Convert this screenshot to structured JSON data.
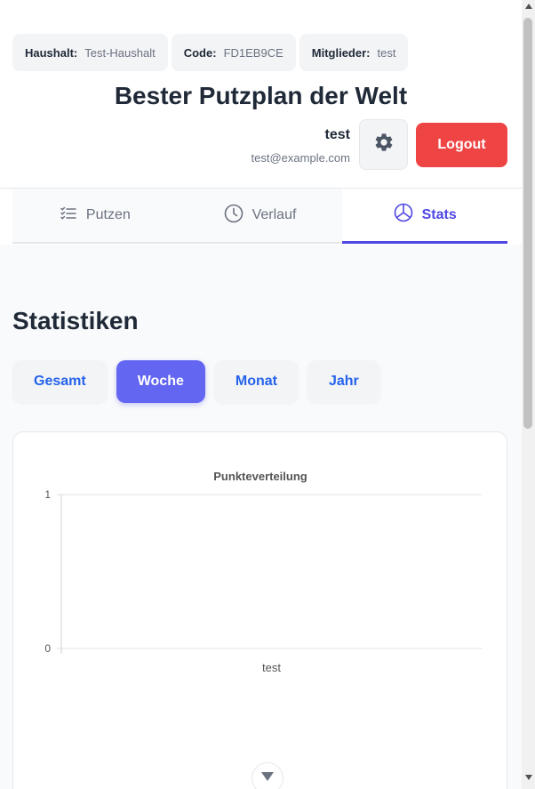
{
  "household": {
    "household_label": "Haushalt:",
    "household_value": "Test-Haushalt",
    "code_label": "Code:",
    "code_value": "FD1EB9CE",
    "members_label": "Mitglieder:",
    "members_value": "test"
  },
  "app": {
    "title": "Bester Putzplan der Welt"
  },
  "user": {
    "name": "test",
    "email": "test@example.com"
  },
  "header": {
    "settings_icon": "gear-icon",
    "logout_label": "Logout"
  },
  "tabs": [
    {
      "label": "Putzen",
      "icon": "list-check-icon",
      "active": false
    },
    {
      "label": "Verlauf",
      "icon": "clock-icon",
      "active": false
    },
    {
      "label": "Stats",
      "icon": "pie-chart-icon",
      "active": true
    }
  ],
  "stats": {
    "title": "Statistiken",
    "filters": [
      {
        "label": "Gesamt",
        "active": false
      },
      {
        "label": "Woche",
        "active": true
      },
      {
        "label": "Monat",
        "active": false
      },
      {
        "label": "Jahr",
        "active": false
      }
    ]
  },
  "colors": {
    "accent": "#4f46e5",
    "active_filter": "#6366f1",
    "logout": "#ef4444",
    "filter_text": "#2563eb"
  },
  "chart_data": {
    "type": "bar",
    "title": "Punkteverteilung",
    "categories": [
      "test"
    ],
    "series": [
      {
        "values": [
          0
        ]
      }
    ],
    "ylim": [
      0,
      1
    ],
    "yticks": [
      "1",
      "0"
    ],
    "xlabel": "",
    "ylabel": ""
  }
}
